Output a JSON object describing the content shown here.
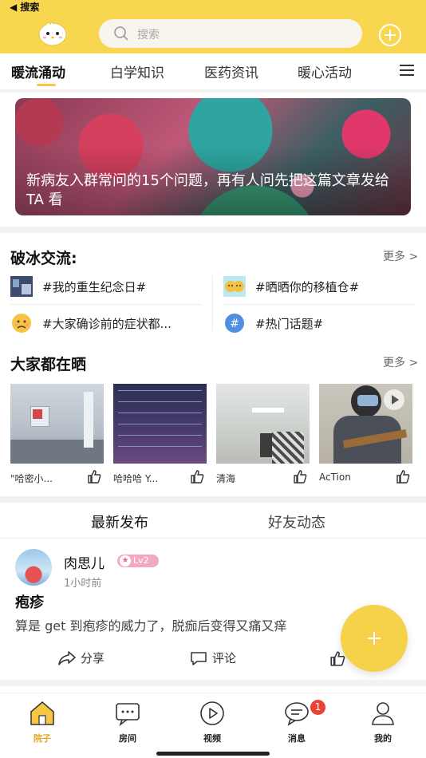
{
  "status_bar": {
    "back_label": "◀ 搜索"
  },
  "search": {
    "placeholder": "搜索"
  },
  "tabs": [
    {
      "label": "暖流涌动",
      "active": true
    },
    {
      "label": "白学知识",
      "active": false
    },
    {
      "label": "医药资讯",
      "active": false
    },
    {
      "label": "暖心活动",
      "active": false
    }
  ],
  "banner": {
    "title": "新病友入群常问的15个问题，再有人问先把这篇文章发给 TA 看"
  },
  "topics_section": {
    "title": "破冰交流:",
    "more": "更多 >",
    "items": [
      {
        "label": "#我的重生纪念日#",
        "icon": "photo-icon"
      },
      {
        "label": "#晒晒你的移植仓#",
        "icon": "emoji-faces-icon"
      },
      {
        "label": "#大家确诊前的症状都...",
        "icon": "worried-face-icon"
      },
      {
        "label": "#热门话题#",
        "icon": "hashtag-icon"
      }
    ]
  },
  "share_section": {
    "title": "大家都在晒",
    "more": "更多 >",
    "cards": [
      {
        "caption": "\"哈密小...",
        "image": "room-photo"
      },
      {
        "caption": "哈哈哈 Y...",
        "image": "schedule-screenshot"
      },
      {
        "caption": "清海",
        "image": "ward-photo"
      },
      {
        "caption": "AcTion",
        "image": "ukulele-video",
        "video": true
      }
    ]
  },
  "feed_tabs": [
    {
      "label": "最新发布",
      "active": true
    },
    {
      "label": "好友动态",
      "active": false
    }
  ],
  "post": {
    "username": "肉思儿",
    "level": "Lv2",
    "time": "1小时前",
    "title": "疱疹",
    "body": "算是 get 到疱疹的威力了，脱痂后变得又痛又痒",
    "actions": {
      "share": "分享",
      "comment": "评论",
      "like": "赞"
    }
  },
  "bottom_nav": [
    {
      "label": "院子",
      "icon": "house-icon",
      "active": true
    },
    {
      "label": "房间",
      "icon": "chat-room-icon",
      "active": false
    },
    {
      "label": "视频",
      "icon": "play-icon",
      "active": false
    },
    {
      "label": "消息",
      "icon": "message-icon",
      "active": false,
      "badge": "1"
    },
    {
      "label": "我的",
      "icon": "profile-icon",
      "active": false
    }
  ],
  "colors": {
    "brand_yellow": "#f8d64f",
    "accent_orange": "#e8a623",
    "badge_red": "#e94335"
  }
}
